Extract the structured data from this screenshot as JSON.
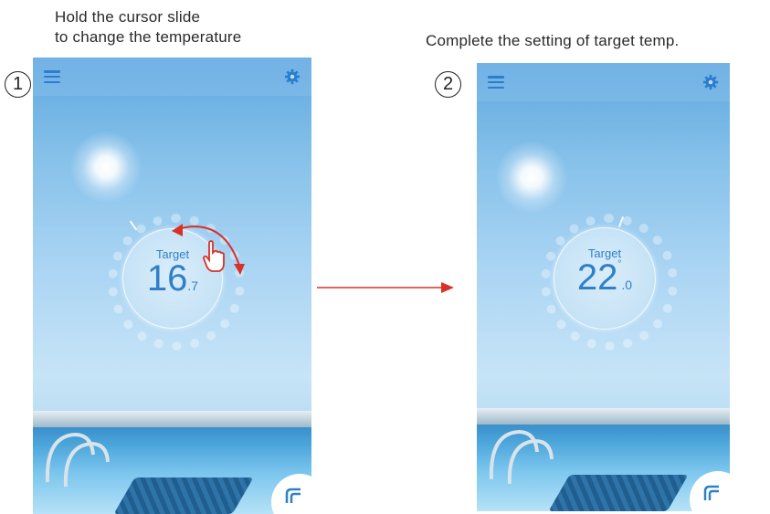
{
  "captions": {
    "step1": "Hold the cursor slide to change the temperature",
    "step1_line1": "Hold the cursor slide",
    "step1_line2": "to change the temperature",
    "step2": "Complete the setting of target temp."
  },
  "steps": {
    "one": "1",
    "two": "2"
  },
  "screen1": {
    "label": "Target",
    "temp_int": "16",
    "temp_dec": ".7"
  },
  "screen2": {
    "label": "Target",
    "temp_int": "22",
    "temp_dec": ".0",
    "degree": "°"
  },
  "icons": {
    "menu": "menu-icon",
    "settings": "gear-icon",
    "corner": "arrow-corner-icon",
    "hand": "hand-cursor-icon"
  },
  "colors": {
    "accent": "#2f80c8",
    "arrow": "#d9302a"
  }
}
